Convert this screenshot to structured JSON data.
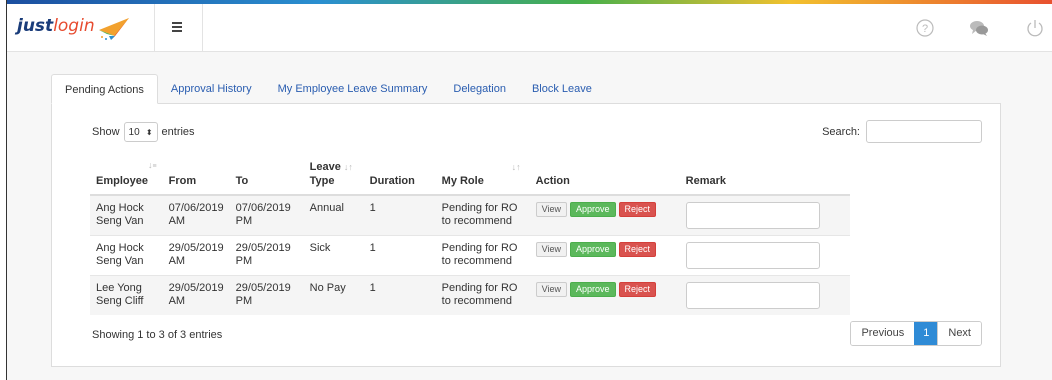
{
  "brand": {
    "part1": "just",
    "part2": "login"
  },
  "tabs": [
    {
      "label": "Pending Actions"
    },
    {
      "label": "Approval History"
    },
    {
      "label": "My Employee Leave Summary"
    },
    {
      "label": "Delegation"
    },
    {
      "label": "Block Leave"
    }
  ],
  "controls": {
    "show_label": "Show",
    "entries_value": "10",
    "entries_label": "entries",
    "search_label": "Search:",
    "search_value": ""
  },
  "table": {
    "headers": {
      "employee": "Employee",
      "from": "From",
      "to": "To",
      "leave_type_1": "Leave",
      "leave_type_2": "Type",
      "duration": "Duration",
      "my_role": "My Role",
      "action": "Action",
      "remark": "Remark"
    },
    "rows": [
      {
        "emp1": "Ang Hock",
        "emp2": "Seng Van",
        "from1": "07/06/2019",
        "from2": "AM",
        "to1": "07/06/2019",
        "to2": "PM",
        "type": "Annual",
        "duration": "1",
        "role1": "Pending for RO",
        "role2": "to recommend"
      },
      {
        "emp1": "Ang Hock",
        "emp2": "Seng Van",
        "from1": "29/05/2019",
        "from2": "AM",
        "to1": "29/05/2019",
        "to2": "PM",
        "type": "Sick",
        "duration": "1",
        "role1": "Pending for RO",
        "role2": "to recommend"
      },
      {
        "emp1": "Lee Yong",
        "emp2": "Seng Cliff",
        "from1": "29/05/2019",
        "from2": "AM",
        "to1": "29/05/2019",
        "to2": "PM",
        "type": "No Pay",
        "duration": "1",
        "role1": "Pending for RO",
        "role2": "to recommend"
      }
    ],
    "buttons": {
      "view": "View",
      "approve": "Approve",
      "reject": "Reject"
    }
  },
  "footer": {
    "info": "Showing 1 to 3 of 3 entries",
    "prev": "Previous",
    "page": "1",
    "next": "Next"
  },
  "icons": {
    "help": "help-circle-icon",
    "chat": "chat-bubbles-icon",
    "power": "power-icon",
    "menu": "hamburger-menu-icon",
    "sort": "sort-arrows-icon"
  },
  "colors": {
    "link": "#2a5db0",
    "approve": "#5cb85c",
    "reject": "#d9534f",
    "page_active": "#2f8bd6"
  }
}
